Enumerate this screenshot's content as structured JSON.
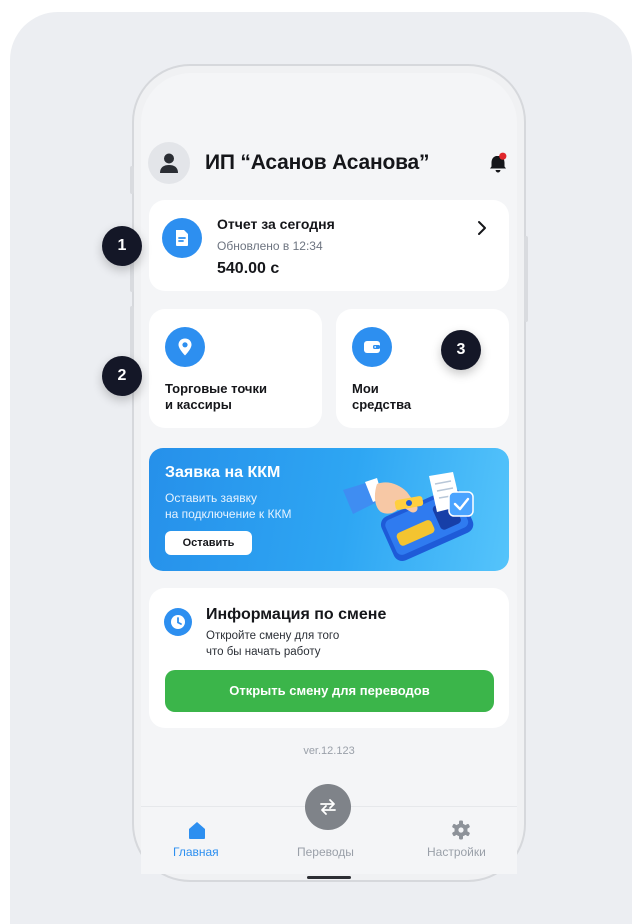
{
  "header": {
    "title": "ИП “Асанов Асанова”"
  },
  "report": {
    "title": "Отчет за сегодня",
    "updated": "Обновлено в 12:34",
    "amount": "540.00 с"
  },
  "tiles": {
    "outlets": {
      "line1": "Торговые точки",
      "line2": "и кассиры"
    },
    "funds": {
      "line1": "Мои",
      "line2": "средства"
    }
  },
  "badges": [
    "1",
    "2",
    "3"
  ],
  "banner": {
    "title": "Заявка на ККМ",
    "sub1": "Оставить заявку",
    "sub2": "на подключение к ККМ",
    "button": "Оставить"
  },
  "shift": {
    "title": "Информация по смене",
    "sub1": "Откройте смену для того",
    "sub2": "что бы начать работу",
    "button": "Открыть смену для переводов"
  },
  "version": "ver.12.123",
  "tabs": [
    {
      "label": "Главная",
      "icon": "home-icon",
      "active": true
    },
    {
      "label": "Переводы",
      "icon": "transfer-icon",
      "active": false
    },
    {
      "label": "Настройки",
      "icon": "gear-icon",
      "active": false
    }
  ],
  "colors": {
    "accent": "#2d8ff0",
    "green": "#3bb54a",
    "badge": "#141727",
    "notify": "#e0262b"
  }
}
